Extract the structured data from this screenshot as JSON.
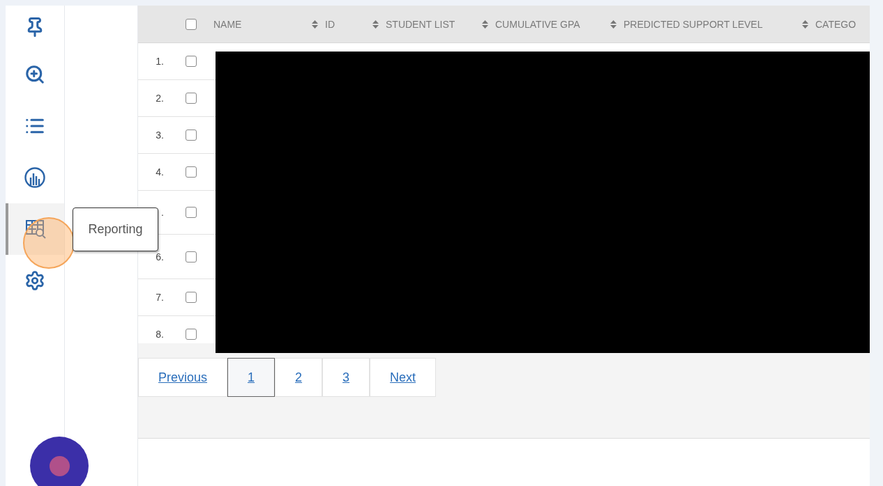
{
  "sidebar": {
    "items": [
      {
        "kind": "pin",
        "selected": false
      },
      {
        "kind": "zoom",
        "selected": false
      },
      {
        "kind": "list",
        "selected": false
      },
      {
        "kind": "chart",
        "selected": false
      },
      {
        "kind": "report",
        "selected": true
      },
      {
        "kind": "settings",
        "selected": false
      }
    ],
    "tooltip": "Reporting"
  },
  "table": {
    "select_all": {
      "checked": false
    },
    "columns": [
      {
        "label": "NAME"
      },
      {
        "label": "ID"
      },
      {
        "label": "STUDENT LIST"
      },
      {
        "label": "CUMULATIVE GPA"
      },
      {
        "label": "PREDICTED SUPPORT LEVEL"
      },
      {
        "label": "CATEGO"
      }
    ],
    "rows": [
      {
        "number": "1.",
        "checked": false
      },
      {
        "number": "2.",
        "checked": false
      },
      {
        "number": "3.",
        "checked": false
      },
      {
        "number": "4.",
        "checked": false
      },
      {
        "number": ".",
        "checked": false
      },
      {
        "number": "6.",
        "checked": false
      },
      {
        "number": "7.",
        "checked": false
      },
      {
        "number": "8.",
        "checked": false
      }
    ]
  },
  "pagination": [
    {
      "label": "Previous",
      "selected": false
    },
    {
      "label": "1",
      "selected": true
    },
    {
      "label": "2",
      "selected": false
    },
    {
      "label": "3",
      "selected": false
    },
    {
      "label": "Next",
      "selected": false
    }
  ]
}
